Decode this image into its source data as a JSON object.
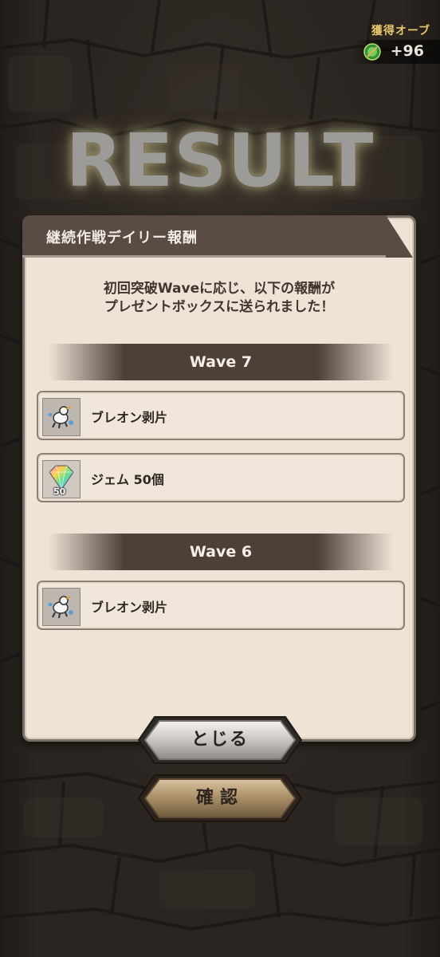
{
  "orb_counter": {
    "label": "獲得オーブ",
    "value": "+96"
  },
  "result_title": "RESULT",
  "panel": {
    "title": "継続作戦デイリー報酬",
    "message_line1": "初回突破Waveに応じ、以下の報酬が",
    "message_line2": "プレゼントボックスに送られました！",
    "waves": [
      {
        "label": "Wave  7",
        "items": [
          {
            "name": "ブレオン剥片",
            "icon": "breon-fragment-icon"
          },
          {
            "name": "ジェム 50個",
            "icon": "gem-icon",
            "count": "50"
          }
        ]
      },
      {
        "label": "Wave  6",
        "items": [
          {
            "name": "ブレオン剥片",
            "icon": "breon-fragment-icon"
          }
        ]
      }
    ]
  },
  "buttons": {
    "close": "とじる",
    "confirm": "確認"
  },
  "colors": {
    "panel_bg": "#efe3d6",
    "header_bg": "#5a4c44",
    "gold": "#e7c86a",
    "title_glow": "#f0e6aa"
  }
}
